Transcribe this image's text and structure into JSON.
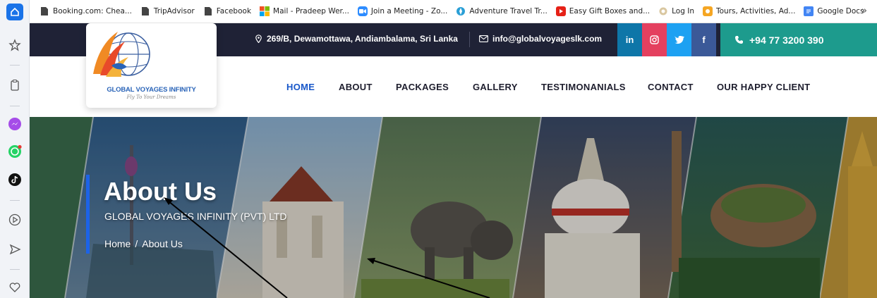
{
  "bookmarks": [
    {
      "label": "Booking.com: Chea...",
      "icon": "document-icon"
    },
    {
      "label": "TripAdvisor",
      "icon": "document-icon"
    },
    {
      "label": "Facebook",
      "icon": "document-icon"
    },
    {
      "label": "Mail - Pradeep Wer...",
      "icon": "microsoft-icon"
    },
    {
      "label": "Join a Meeting - Zo...",
      "icon": "zoom-icon"
    },
    {
      "label": "Adventure Travel Tr...",
      "icon": "compass-icon"
    },
    {
      "label": "Easy Gift Boxes and...",
      "icon": "youtube-icon"
    },
    {
      "label": "Log In",
      "icon": "cloud-icon"
    },
    {
      "label": "Tours, Activities, Ad...",
      "icon": "tours-icon"
    },
    {
      "label": "Google Docs",
      "icon": "docs-icon"
    }
  ],
  "bookmarks_more": "»",
  "topbar": {
    "address": "269/B, Dewamottawa, Andiambalama, Sri Lanka",
    "email": "info@globalvoyageslk.com",
    "social": [
      {
        "label": "in",
        "icon": "linkedin-icon",
        "color": "#0e76a8"
      },
      {
        "label": "",
        "icon": "instagram-icon",
        "color": "#e4405f"
      },
      {
        "label": "",
        "icon": "twitter-icon",
        "color": "#1da1f2"
      },
      {
        "label": "f",
        "icon": "facebook-icon",
        "color": "#3b5998"
      }
    ],
    "phone": "+94 77 3200 390"
  },
  "logo": {
    "name": "GLOBAL VOYAGES INFINITY",
    "tagline": "Fly To Your Dreams"
  },
  "nav": [
    {
      "label": "HOME",
      "active": true
    },
    {
      "label": "ABOUT"
    },
    {
      "label": "PACKAGES"
    },
    {
      "label": "GALLERY"
    },
    {
      "label": "TESTIMONANIALS"
    },
    {
      "label": "CONTACT"
    },
    {
      "label": "OUR HAPPY CLIENT"
    }
  ],
  "hero": {
    "title": "About Us",
    "subtitle": "GLOBAL VOYAGES INFINITY (PVT) LTD",
    "breadcrumb": {
      "home": "Home",
      "separator": "/",
      "current": "About Us"
    }
  },
  "colors": {
    "topbar_bg": "#1f2236",
    "phone_bg": "#1d9b8d",
    "nav_active": "#1857c9",
    "accent_bar": "#1c63e8"
  }
}
